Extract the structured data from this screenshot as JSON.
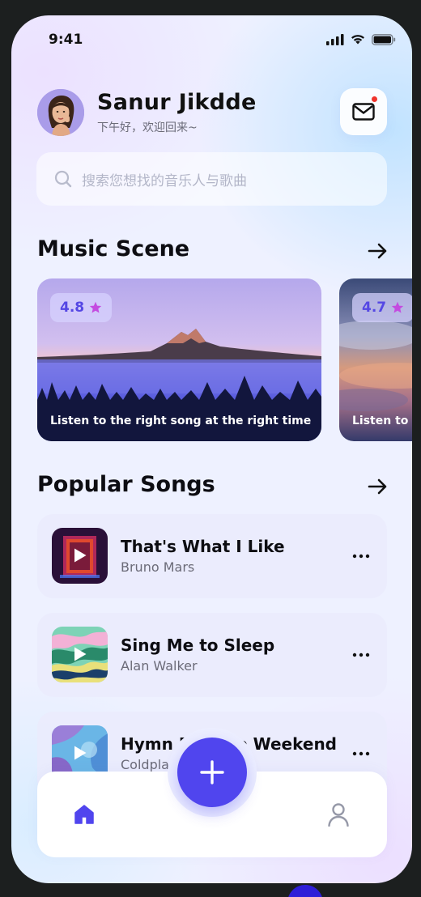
{
  "status_bar": {
    "time": "9:41"
  },
  "header": {
    "user_name": "Sanur Jikdde",
    "greeting": "下午好，欢迎回来~"
  },
  "search": {
    "placeholder": "搜索您想找的音乐人与歌曲"
  },
  "music_scene": {
    "title": "Music Scene",
    "cards": [
      {
        "rating": "4.8",
        "caption": "Listen to the right song at the right time"
      },
      {
        "rating": "4.7",
        "caption": "Listen to the right song at the right time"
      }
    ]
  },
  "popular_songs": {
    "title": "Popular Songs",
    "items": [
      {
        "title": "That's What I Like",
        "artist": "Bruno Mars"
      },
      {
        "title": "Sing Me to Sleep",
        "artist": "Alan Walker"
      },
      {
        "title": "Hymn For The Weekend",
        "artist": "Coldplay"
      }
    ]
  },
  "tab_bar": {
    "items": [
      {
        "icon": "home-icon",
        "active": true
      },
      {
        "icon": "plus-icon",
        "active": false
      },
      {
        "icon": "profile-icon",
        "active": false
      }
    ]
  },
  "colors": {
    "accent": "#5045ee",
    "rating_text": "#5547e4",
    "star": "#c44be0",
    "notification": "#f0342c"
  }
}
